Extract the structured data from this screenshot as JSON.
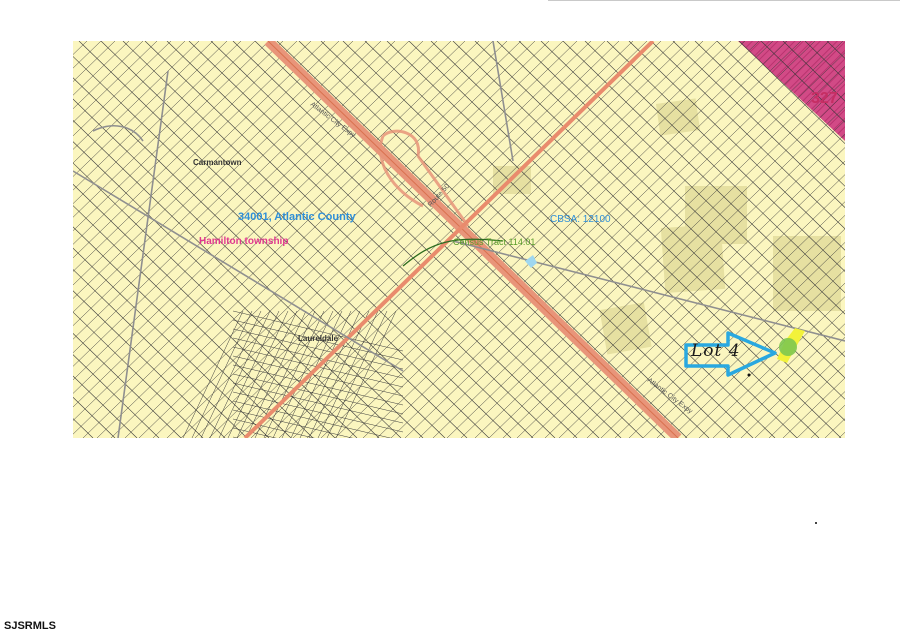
{
  "map": {
    "county_label": "34001, Atlantic County",
    "township_label": "Hamilton township",
    "cbsa_label": "CBSA: 12100",
    "tract_label": "Census Tract 114.01",
    "towns": {
      "carmantown": "Carmantown",
      "laureldale": "Laureldale"
    },
    "roads": {
      "expressway": "Atlantic City Expy",
      "route": "Route 50"
    },
    "adjacent_area_label": "327",
    "annotation": {
      "lot_text": "Lot 4",
      "arrow_color": "#29a8e0",
      "highlight_color": "#f2f23a",
      "marker_color": "#7ec850"
    },
    "colors": {
      "parcel_fill": "#fbf6bf",
      "park_fill": "#e6e0a1",
      "pink_area": "#d24a86",
      "highway": "#e8957a"
    }
  },
  "footer": {
    "mls_label": "SJSRMLS"
  }
}
